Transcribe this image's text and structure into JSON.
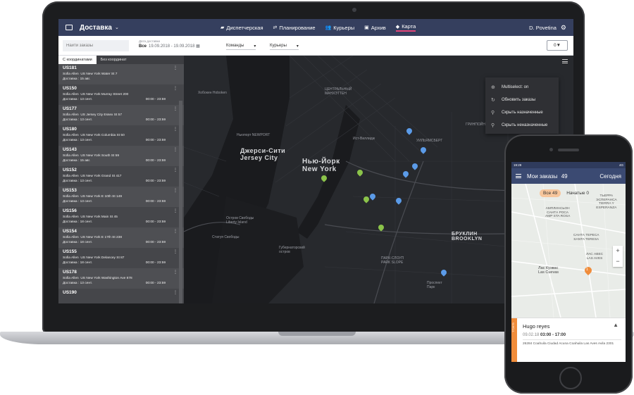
{
  "app": {
    "name": "Доставка",
    "nav": [
      {
        "label": "Диспетчерская",
        "icon": "truck-icon"
      },
      {
        "label": "Планирование",
        "icon": "route-icon"
      },
      {
        "label": "Курьеры",
        "icon": "people-icon"
      },
      {
        "label": "Архив",
        "icon": "archive-icon"
      },
      {
        "label": "Карта",
        "icon": "layers-icon",
        "active": true
      }
    ],
    "user": "D. Povetina"
  },
  "filters": {
    "search_placeholder": "Найти заказы",
    "date_label": "Дата доставки",
    "date_all": "Все",
    "date_range": "19.09.2018 - 19.09.2018",
    "teams_label": "Команды",
    "couriers_label": "Курьеры",
    "filter_count": "0"
  },
  "orders_panel": {
    "tabs": [
      "С координатами",
      "Без координат"
    ],
    "orders": [
      {
        "id": "US181",
        "client": "Sofia Allen",
        "address": "US New York Water St 7",
        "delivery": "Доставка : 15 авг.",
        "time": ""
      },
      {
        "id": "US150",
        "client": "Sofia Allen",
        "address": "US New York Murray Street 200",
        "delivery": "Доставка : 13 сент.",
        "time": "00:00 - 23:59"
      },
      {
        "id": "US177",
        "client": "Sofia Allen",
        "address": "US Jersey City Essex St 57",
        "delivery": "Доставка : 13 сент.",
        "time": "00:00 - 23:59"
      },
      {
        "id": "US180",
        "client": "Sofia Allen",
        "address": "US New York Columbia St 50",
        "delivery": "Доставка : 13 сент.",
        "time": "00:00 - 23:59"
      },
      {
        "id": "US143",
        "client": "Sofia Allen",
        "address": "US New York South St 59",
        "delivery": "Доставка : 15 авг.",
        "time": "00:00 - 23:59"
      },
      {
        "id": "US152",
        "client": "Sofia Allen",
        "address": "US New York Grand St 417",
        "delivery": "Доставка : 13 сент.",
        "time": "00:00 - 23:59"
      },
      {
        "id": "US153",
        "client": "Sofia Allen",
        "address": "US New York E 10th St 149",
        "delivery": "Доставка : 13 сент.",
        "time": "00:00 - 23:59"
      },
      {
        "id": "US156",
        "client": "Sofia Allen",
        "address": "US New York Main St 45",
        "delivery": "Доставка : 18 сент.",
        "time": "00:00 - 23:59"
      },
      {
        "id": "US154",
        "client": "Sofia Allen",
        "address": "US New York E 17th St 238",
        "delivery": "Доставка : 18 сент.",
        "time": "00:00 - 23:59"
      },
      {
        "id": "US155",
        "client": "Sofia Allen",
        "address": "US New York Delancey St 87",
        "delivery": "Доставка : 18 сент.",
        "time": "00:00 - 23:59"
      },
      {
        "id": "US178",
        "client": "Sofia Allen",
        "address": "US New York Washington Ave 878",
        "delivery": "Доставка : 13 сент.",
        "time": "00:00 - 23:59"
      },
      {
        "id": "US190",
        "client": "",
        "address": "",
        "delivery": "",
        "time": ""
      }
    ]
  },
  "map": {
    "labels": {
      "jersey": "Джерси-Сити\nJersey City",
      "newyork": "Нью-Йорк\nNew York",
      "brooklyn": "БРУКЛИН\nBROOKLYN",
      "hoboken": "Хобокен\nHoboken",
      "midtown": "ЦЕНТРАЛЬНЫЙ\nМАНХЭТТЕН",
      "east_village": "Ист-Виллидж",
      "williamsburg": "УИЛЬЯМСБЕРГ",
      "greenpoint": "ГРИНПОЙНТ",
      "park_slope": "ПАРК-СЛОУП\nPARK SLOPE",
      "liberty": "Остров Свободы\nLiberty Island",
      "statue": "Статуя Свободы",
      "governors": "Губернаторский\nостров",
      "prospect": "Проспект\nПарк",
      "newport": "Ньюпорт\nNEWPORT"
    },
    "context_menu": [
      {
        "label": "Multiselect: on",
        "icon": "multiselect-icon"
      },
      {
        "label": "Обновить заказы",
        "icon": "refresh-icon"
      },
      {
        "label": "Скрыть назначенные",
        "icon": "bike-icon"
      },
      {
        "label": "Скрыть неназначенные",
        "icon": "bike-icon"
      }
    ]
  },
  "phone": {
    "status_time": "19:29",
    "status_right": "4G",
    "title": "Мои заказы",
    "count": "49",
    "today": "Сегодня",
    "chip_all": "Все 49",
    "chip_started": "Начатые 0",
    "map_labels": {
      "amp": "АМПЛИАСЬОН\nСАНТА РОСА\nAMP STA ROSA",
      "tierra": "ТЬЕРРА\nЭСПЕРАНСА\nTIERRA Y\nESPERANZA",
      "santa_teresa": "САНТА ТЕРЕСА\nSANTA TERESA",
      "las_aves": "ЛАС АВЕС\nLAS AVES",
      "las_cuevas": "Лас Куэвас\nLas Cuevas"
    },
    "marker": "1",
    "card": {
      "id": "TT2679",
      "name": "Hugo  reyes",
      "date": "09.02.18",
      "time": "03:00 - 17:00",
      "address": "26284 Coahuila Ciudad Acuna Coahuila Las Aves Avila 2301"
    }
  }
}
